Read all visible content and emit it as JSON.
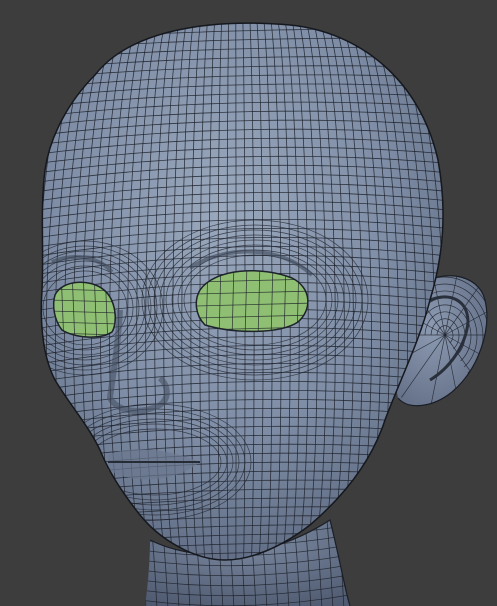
{
  "scene": {
    "background_color": "#3d3d3d",
    "mesh_color": "#7f8ea6",
    "mesh_shadow_color": "#5d6a80",
    "wire_color": "#1d222b",
    "eye_fill_color": "#8fbf72",
    "subject": "wireframe-head-model",
    "display_mode": "wireframe-over-solid"
  }
}
